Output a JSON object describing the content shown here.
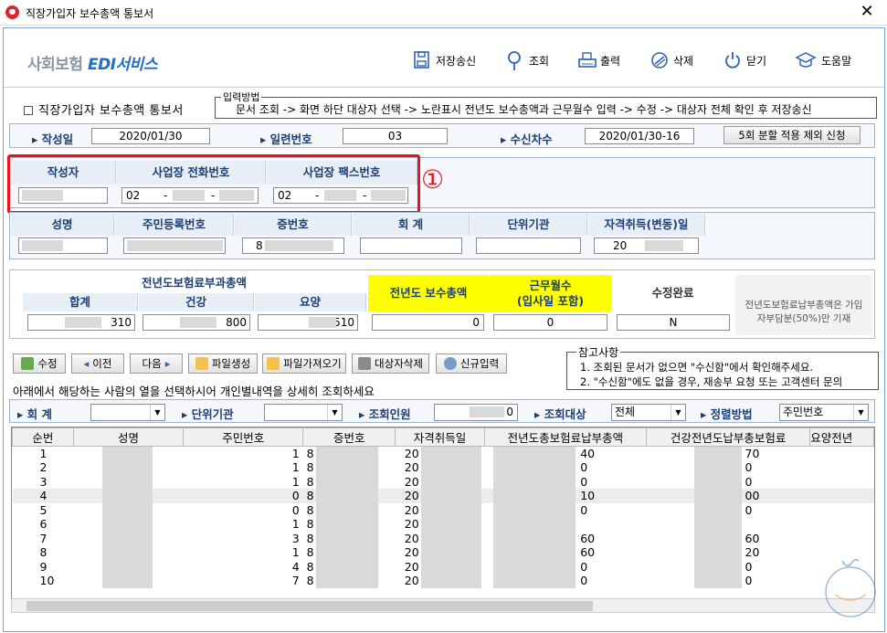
{
  "window": {
    "title": "직장가입자 보수총액 통보서",
    "close": "✕"
  },
  "brand": {
    "prefix": "사회보험 ",
    "suffix": "EDI서비스"
  },
  "toolbar": {
    "items": [
      {
        "label": "저장송신",
        "icon": "save-icon"
      },
      {
        "label": "조회",
        "icon": "search-pin-icon"
      },
      {
        "label": "출력",
        "icon": "printer-icon"
      },
      {
        "label": "삭제",
        "icon": "delete-icon"
      },
      {
        "label": "닫기",
        "icon": "power-icon"
      },
      {
        "label": "도움말",
        "icon": "graduation-cap-icon"
      }
    ]
  },
  "form_title": "직장가입자 보수총액 통보서",
  "input_method": {
    "legend": "입력방법",
    "text": "문서 조회 -> 화면 하단 대상자 선택 -> 노란표시 전년도 보수총액과 근무월수 입력 -> 수정 -> 대상자 전체 확인 후 저장송신"
  },
  "info_row": {
    "date_label": "작성일",
    "date": "2020/01/30",
    "serial_label": "일련번호",
    "serial": "03",
    "recv_label": "수신차수",
    "recv": "2020/01/30-16",
    "apply_button": "5회 분할 적용 제외 신청"
  },
  "writer": {
    "writer_label": "작성자",
    "phone_label": "사업장 전화번호",
    "fax_label": "사업장 팩스번호",
    "phone_prefix": "02",
    "fax_prefix": "02",
    "dash": "-",
    "marker": "①"
  },
  "person": {
    "name_label": "성명",
    "rrn_label": "주민등록번호",
    "cert_label": "증번호",
    "account_label": "회 계",
    "unit_label": "단위기관",
    "qual_label": "자격취득(변동)일",
    "cert_value": "8",
    "qual_value": "20      /"
  },
  "premium": {
    "group_label": "전년도보험료부과총액",
    "total_label": "합계",
    "health_label": "건강",
    "care_label": "요양",
    "total": "310",
    "health": "800",
    "care": "510",
    "pay_label": "전년도 보수총액",
    "pay": "0",
    "months_label1": "근무월수",
    "months_label2": "(입사일 포함)",
    "months": "0",
    "done_label": "수정완료",
    "done": "N",
    "note": "전년도보험료납부총액은 가입자부담분(50%)만 기재"
  },
  "buttons": [
    {
      "label": "수정",
      "name": "edit-button"
    },
    {
      "label": "이전",
      "name": "prev-button"
    },
    {
      "label": "다음",
      "name": "next-button"
    },
    {
      "label": "파일생성",
      "name": "create-file-button"
    },
    {
      "label": "파일가져오기",
      "name": "import-file-button"
    },
    {
      "label": "대상자삭제",
      "name": "delete-target-button"
    },
    {
      "label": "신규입력",
      "name": "new-entry-button"
    }
  ],
  "reference": {
    "legend": "참고사항",
    "line1": "1. 조회된 문서가 없으면 \"수신함\"에서 확인해주세요.",
    "line2": "2. \"수신함\"에도 없을 경우, 재송부 요청 또는 고객센터 문의"
  },
  "instruction": "아래에서 해당하는 사람의 열을 선택하시어 개인별내역을 상세히 조회하세요",
  "filter": {
    "account_label": "회  계",
    "unit_label": "단위기관",
    "count_label": "조회인원",
    "count": "0",
    "target_label": "조회대상",
    "target": "전체",
    "sort_label": "정렬방법",
    "sort": "주민번호"
  },
  "grid": {
    "columns": [
      "순번",
      "성명",
      "주민번호",
      "증번호",
      "자격취득일",
      "전년도총보험료납부총액",
      "건강전년도납부총보험료",
      "요양전년"
    ],
    "rows": [
      {
        "no": "1",
        "rrn": "1",
        "cert": "8",
        "qual": "20",
        "total": "40",
        "health": "70"
      },
      {
        "no": "2",
        "rrn": "1",
        "cert": "8",
        "qual": "20",
        "total": "0",
        "health": "0"
      },
      {
        "no": "3",
        "rrn": "1",
        "cert": "8",
        "qual": "20",
        "total": "0",
        "health": "0"
      },
      {
        "no": "4",
        "rrn": "0",
        "cert": "8",
        "qual": "20",
        "total": "10",
        "health": "00"
      },
      {
        "no": "5",
        "rrn": "0",
        "cert": "8",
        "qual": "20",
        "total": "0",
        "health": "0"
      },
      {
        "no": "6",
        "rrn": "1",
        "cert": "8",
        "qual": "20",
        "total": "",
        "health": ""
      },
      {
        "no": "7",
        "rrn": "3",
        "cert": "8",
        "qual": "20",
        "total": "60",
        "health": "60"
      },
      {
        "no": "8",
        "rrn": "1",
        "cert": "8",
        "qual": "20",
        "total": "60",
        "health": "20"
      },
      {
        "no": "9",
        "rrn": "4",
        "cert": "8",
        "qual": "20",
        "total": "0",
        "health": "0"
      },
      {
        "no": "10",
        "rrn": "7",
        "cert": "8",
        "qual": "20",
        "total": "0",
        "health": "0"
      }
    ]
  },
  "colors": {
    "accent": "#1d3f74",
    "highlight": "#ffff00",
    "marker": "#e8141c"
  }
}
